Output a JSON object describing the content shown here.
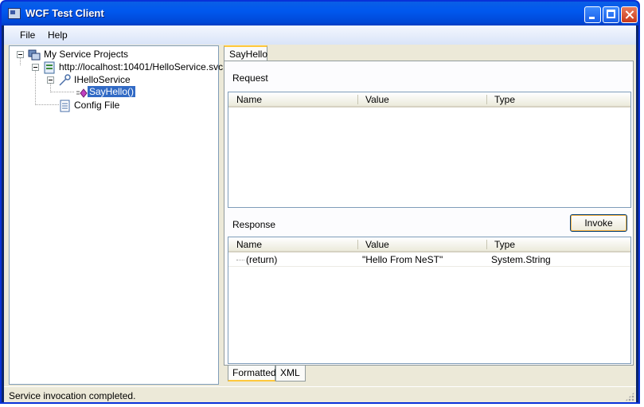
{
  "window": {
    "title": "WCF Test Client"
  },
  "menu": {
    "items": [
      "File",
      "Help"
    ]
  },
  "tree": {
    "root": "My Service Projects",
    "service": "http://localhost:10401/HelloService.svc",
    "contract": "IHelloService",
    "operation": "SayHello()",
    "config": "Config File"
  },
  "main": {
    "tab_label": "SayHello",
    "request": {
      "label": "Request",
      "columns": [
        "Name",
        "Value",
        "Type"
      ]
    },
    "response": {
      "label": "Response",
      "invoke_label": "Invoke",
      "columns": [
        "Name",
        "Value",
        "Type"
      ],
      "rows": [
        {
          "name": "(return)",
          "value": "\"Hello From NeST\"",
          "type": "System.String"
        }
      ]
    },
    "bottom_tabs": [
      "Formatted",
      "XML"
    ]
  },
  "status": {
    "text": "Service invocation completed."
  }
}
